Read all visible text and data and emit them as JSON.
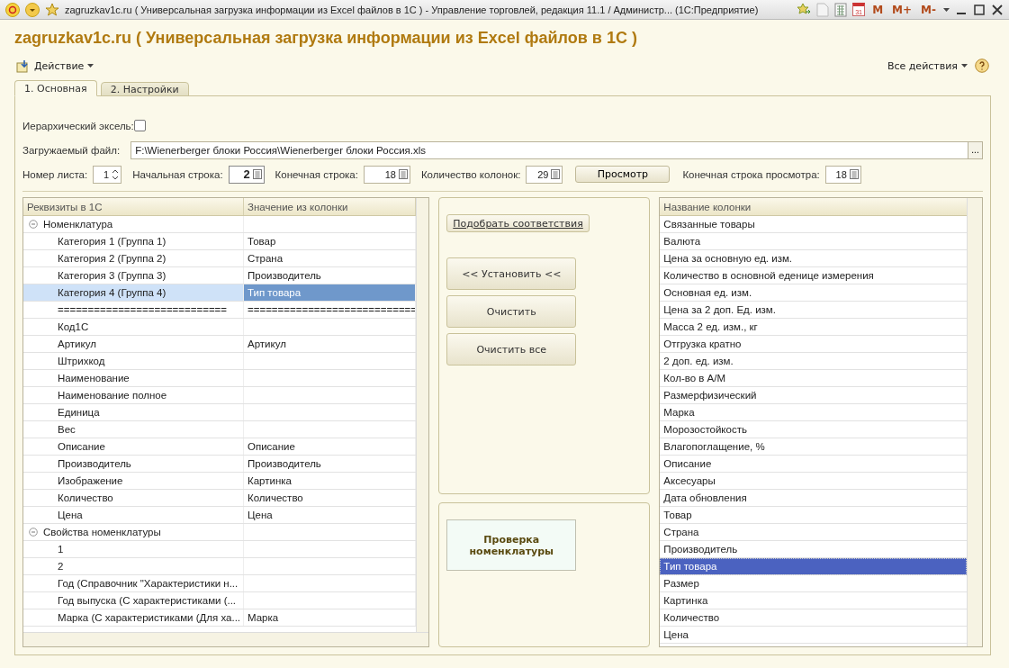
{
  "window": {
    "title": "zagruzkav1c.ru ( Универсальная загрузка информации из Excel файлов в 1С ) - Управление торговлей, редакция 11.1 / Администр...  (1С:Предприятие)",
    "calendar_day": "31",
    "memory_buttons": [
      "M",
      "M+",
      "M-"
    ]
  },
  "heading": "zagruzkav1c.ru ( Универсальная загрузка информации из Excel файлов в 1С )",
  "toolbar": {
    "action": "Действие",
    "all_actions": "Все действия"
  },
  "tabs": [
    {
      "label": "1. Основная",
      "selected": true
    },
    {
      "label": "2. Настройки",
      "selected": false
    }
  ],
  "hierarchical": {
    "label": "Иерархический эксель:",
    "checked": false
  },
  "file": {
    "label": "Загружаемый файл:",
    "value": "F:\\Wienerberger блоки Россия\\Wienerberger блоки Россия.xls",
    "browse": "..."
  },
  "params": [
    {
      "kind": "spin",
      "label": "Номер листа:",
      "value": "1",
      "focused": false
    },
    {
      "kind": "number",
      "label": "Начальная строка:",
      "value": "2",
      "focused": true
    },
    {
      "kind": "number",
      "label": "Конечная строка:",
      "value": "18",
      "focused": false
    },
    {
      "kind": "number",
      "label": "Количество колонок:",
      "value": "29",
      "focused": false
    },
    {
      "kind": "button",
      "label": "Просмотр"
    },
    {
      "kind": "number",
      "label": "Конечная строка просмотра:",
      "value": "18",
      "focused": false
    }
  ],
  "tree": {
    "columns": [
      "Реквизиты в 1С",
      "Значение из колонки"
    ],
    "groups": [
      {
        "label": "Номенклатура",
        "expanded": true,
        "children": [
          {
            "label": "Категория 1 (Группа 1)",
            "value": "Товар",
            "selected": false
          },
          {
            "label": "Категория 2 (Группа 2)",
            "value": "Страна",
            "selected": false
          },
          {
            "label": "Категория 3 (Группа 3)",
            "value": "Производитель",
            "selected": false
          },
          {
            "label": "Категория 4 (Группа 4)",
            "value": "Тип товара",
            "selected": true
          },
          {
            "label": "============================",
            "value": "============================",
            "selected": false
          },
          {
            "label": "Код1С",
            "selected": false
          },
          {
            "label": "Артикул",
            "value": "Артикул",
            "selected": false
          },
          {
            "label": "Штрихкод",
            "selected": false
          },
          {
            "label": "Наименование",
            "selected": false
          },
          {
            "label": "Наименование полное",
            "selected": false
          },
          {
            "label": "Единица",
            "selected": false
          },
          {
            "label": "Вес",
            "selected": false
          },
          {
            "label": "Описание",
            "value": "Описание",
            "selected": false
          },
          {
            "label": "Производитель",
            "value": "Производитель",
            "selected": false
          },
          {
            "label": "Изображение",
            "value": "Картинка",
            "selected": false
          },
          {
            "label": "Количество",
            "value": "Количество",
            "selected": false
          },
          {
            "label": "Цена",
            "value": "Цена",
            "selected": false
          }
        ]
      },
      {
        "label": "Свойства номенклатуры",
        "expanded": true,
        "children": [
          {
            "label": "1",
            "selected": false
          },
          {
            "label": "2",
            "selected": false
          },
          {
            "label": "Год (Справочник \"Характеристики н...",
            "selected": false
          },
          {
            "label": "Год выпуска (С характеристиками (...",
            "selected": false
          },
          {
            "label": "Марка (С характеристиками (Для ха...",
            "value": "Марка",
            "selected": false
          }
        ]
      }
    ]
  },
  "actions": {
    "match": "Подобрать соответствия",
    "buttons": [
      "<< Установить <<",
      "Очистить",
      "Очистить все"
    ],
    "check": "Проверка номенклатуры"
  },
  "columns_list": {
    "header": "Название колонки",
    "items": [
      {
        "label": "Связанные товары",
        "selected": false
      },
      {
        "label": "Валюта",
        "selected": false
      },
      {
        "label": "Цена за основную ед. изм.",
        "selected": false
      },
      {
        "label": "Количество в основной еденице измерения",
        "selected": false
      },
      {
        "label": "Основная ед. изм.",
        "selected": false
      },
      {
        "label": "Цена за 2 доп. Ед. изм.",
        "selected": false
      },
      {
        "label": "Масса 2 ед. изм., кг",
        "selected": false
      },
      {
        "label": "Отгрузка кратно",
        "selected": false
      },
      {
        "label": "2 доп. ед. изм.",
        "selected": false
      },
      {
        "label": "Кол-во в А/М",
        "selected": false
      },
      {
        "label": "Размерфизический",
        "selected": false
      },
      {
        "label": "Марка",
        "selected": false
      },
      {
        "label": "Морозостойкость",
        "selected": false
      },
      {
        "label": "Влагопоглащение, %",
        "selected": false
      },
      {
        "label": "Описание",
        "selected": false
      },
      {
        "label": "Аксесуары",
        "selected": false
      },
      {
        "label": "Дата обновления",
        "selected": false
      },
      {
        "label": "Товар",
        "selected": false
      },
      {
        "label": "Страна",
        "selected": false
      },
      {
        "label": "Производитель",
        "selected": false
      },
      {
        "label": "Тип товара",
        "selected": true
      },
      {
        "label": "Размер",
        "selected": false
      },
      {
        "label": "Картинка",
        "selected": false
      },
      {
        "label": "Количество",
        "selected": false
      },
      {
        "label": "Цена",
        "selected": false
      }
    ]
  }
}
